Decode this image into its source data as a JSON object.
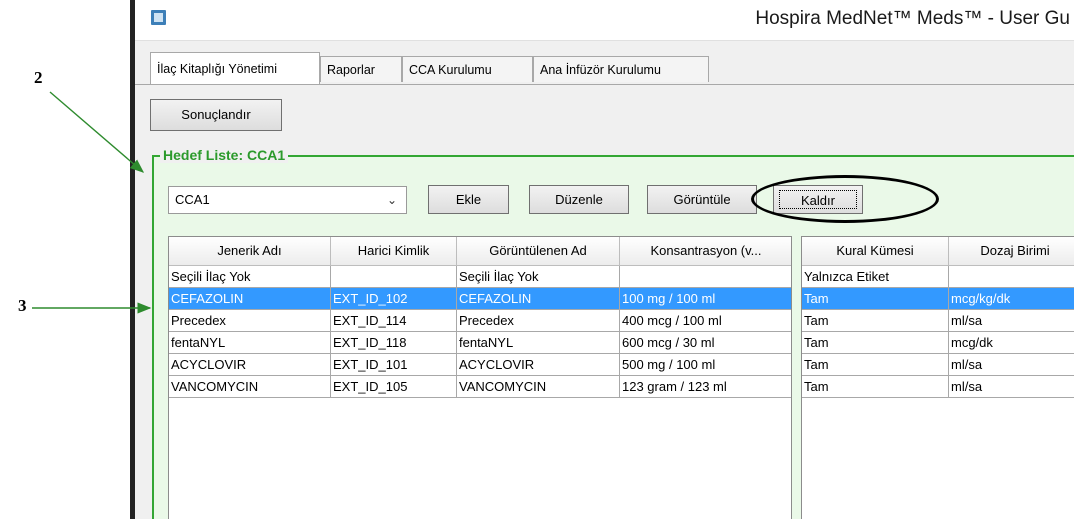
{
  "annotations": {
    "callout_2": "2",
    "callout_3": "3"
  },
  "window": {
    "title": "Hospira MedNet™ Meds™ - User Gu"
  },
  "tabs": [
    {
      "label": "İlaç Kitaplığı Yönetimi",
      "active": true
    },
    {
      "label": "Raporlar"
    },
    {
      "label": "CCA Kurulumu"
    },
    {
      "label": "Ana İnfüzör Kurulumu"
    }
  ],
  "toolbar": {
    "finalize_label": "Sonuçlandır"
  },
  "target_list": {
    "title": "Hedef Liste: CCA1",
    "selected_cca": "CCA1",
    "buttons": {
      "add": "Ekle",
      "edit": "Düzenle",
      "view": "Görüntüle",
      "remove": "Kaldır"
    }
  },
  "left_table": {
    "headers": [
      "Jenerik Adı",
      "Harici Kimlik",
      "Görüntülenen Ad",
      "Konsantrasyon (v..."
    ],
    "rows": [
      [
        "Seçili İlaç Yok",
        "",
        "Seçili İlaç Yok",
        ""
      ],
      [
        "CEFAZOLIN",
        "EXT_ID_102",
        "CEFAZOLIN",
        "100 mg / 100 ml"
      ],
      [
        "Precedex",
        "EXT_ID_114",
        "Precedex",
        "400 mcg / 100 ml"
      ],
      [
        "fentaNYL",
        "EXT_ID_118",
        "fentaNYL",
        "600 mcg / 30 ml"
      ],
      [
        "ACYCLOVIR",
        "EXT_ID_101",
        "ACYCLOVIR",
        "500 mg / 100 ml"
      ],
      [
        "VANCOMYCIN",
        "EXT_ID_105",
        "VANCOMYCIN",
        "123 gram / 123 ml"
      ]
    ]
  },
  "right_table": {
    "headers": [
      "Kural Kümesi",
      "Dozaj Birimi"
    ],
    "rows": [
      [
        "Yalnızca Etiket",
        ""
      ],
      [
        "Tam",
        "mcg/kg/dk"
      ],
      [
        "Tam",
        "ml/sa"
      ],
      [
        "Tam",
        "mcg/dk"
      ],
      [
        "Tam",
        "ml/sa"
      ],
      [
        "Tam",
        "ml/sa"
      ]
    ]
  },
  "selected_row_index": 1,
  "colors": {
    "panel_border": "#33a733",
    "selection": "#3399ff",
    "arrow": "#2e8b2e"
  }
}
